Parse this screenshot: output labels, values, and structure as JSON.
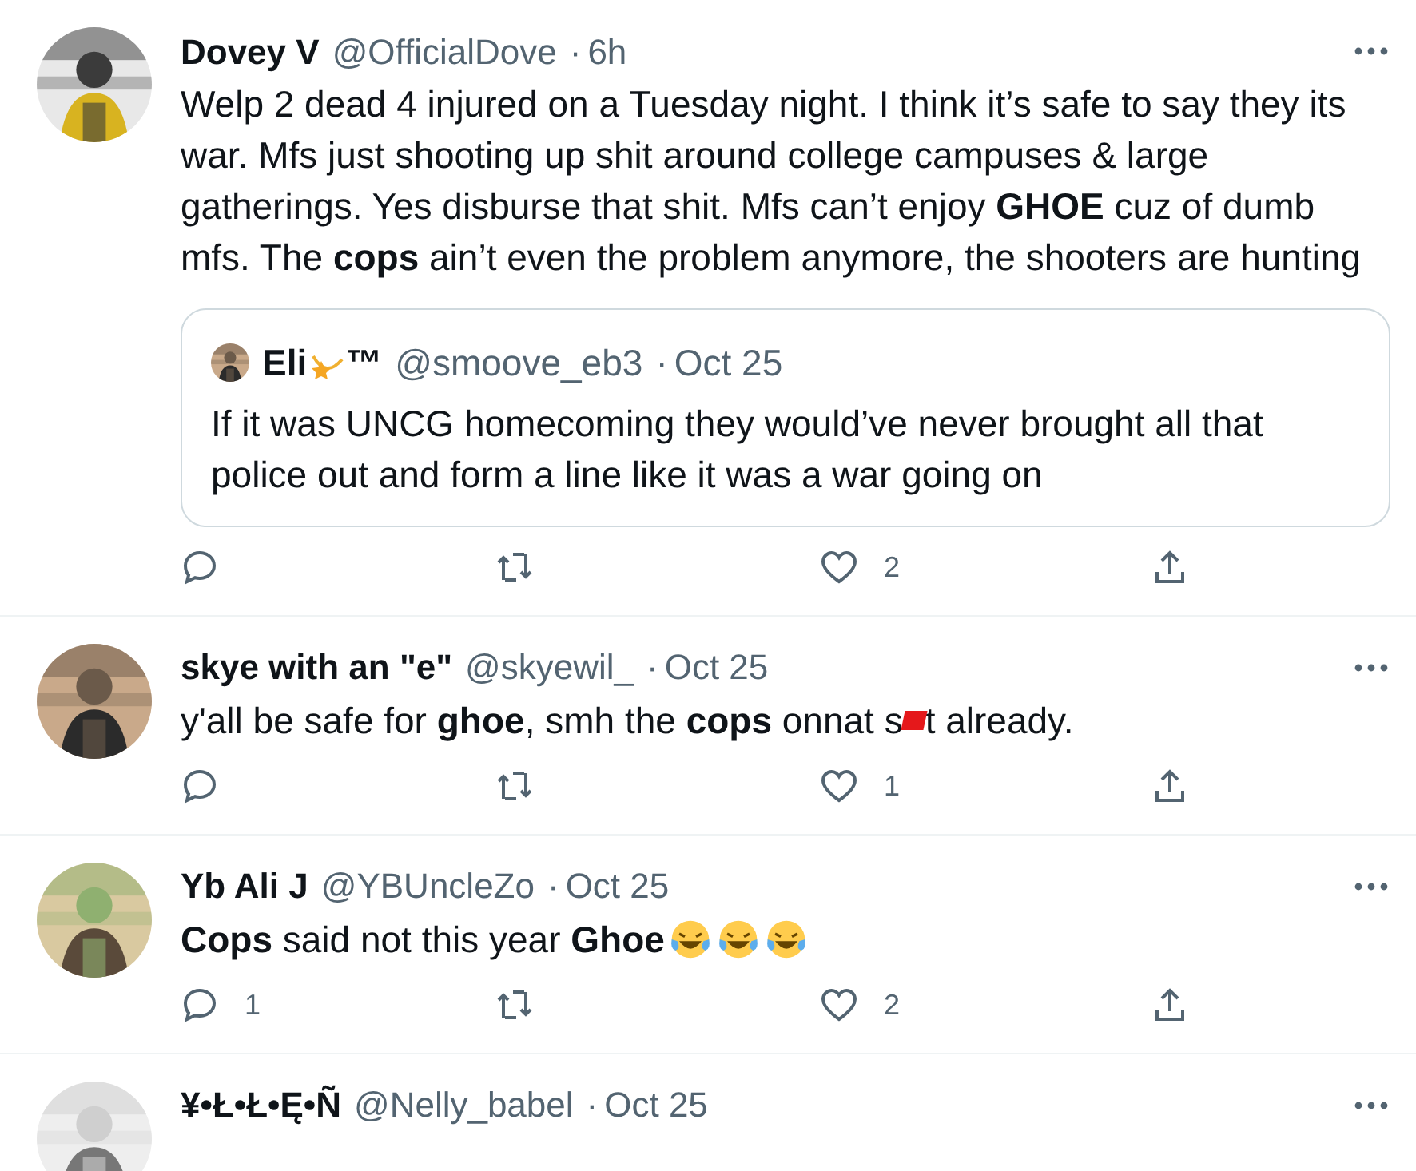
{
  "tweets": [
    {
      "name": [
        {
          "kind": "text",
          "text": "Dovey V"
        }
      ],
      "handle": "@OfficialDove",
      "separator": "·",
      "time": "6h",
      "body": [
        {
          "kind": "text",
          "text": "Welp 2 dead 4 injured on a Tuesday night. I think it’s safe to say they its war. Mfs just shooting up shit around college campuses & large gatherings. Yes disburse that shit. Mfs can’t enjoy **GHOE** cuz of dumb mfs. The **cops** ain’t even the problem anymore, the shooters are hunting"
        }
      ],
      "quote": {
        "name": [
          {
            "kind": "text",
            "text": "Eli"
          },
          {
            "kind": "dizzy"
          },
          {
            "kind": "text",
            "text": "™"
          }
        ],
        "handle": "@smoove_eb3",
        "separator": "·",
        "time": "Oct 25",
        "body": "If it was UNCG homecoming they would’ve never brought all that police out and form a line like it was a war going on"
      },
      "likes": "2"
    },
    {
      "name": [
        {
          "kind": "text",
          "text": "skye with an \"e\""
        }
      ],
      "handle": "@skyewil_",
      "separator": "·",
      "time": "Oct 25",
      "body": [
        {
          "kind": "text",
          "text": "y'all be safe for **ghoe**, smh the **cops** onnat s"
        },
        {
          "kind": "redaction"
        },
        {
          "kind": "text",
          "text": "t already."
        }
      ],
      "likes": "1"
    },
    {
      "name": [
        {
          "kind": "text",
          "text": "Yb Ali J"
        }
      ],
      "handle": "@YBUncleZo",
      "separator": "·",
      "time": "Oct 25",
      "body": [
        {
          "kind": "text",
          "text": "**Cops** said not this year **Ghoe**"
        },
        {
          "kind": "laughing"
        },
        {
          "kind": "laughing"
        },
        {
          "kind": "laughing"
        }
      ],
      "replies": "1",
      "likes": "2"
    },
    {
      "name": [
        {
          "kind": "text",
          "text": "¥•Ł•Ł•Ę•Ñ"
        }
      ],
      "handle": "@Nelly_babel",
      "separator": "·",
      "time": "Oct 25"
    }
  ]
}
